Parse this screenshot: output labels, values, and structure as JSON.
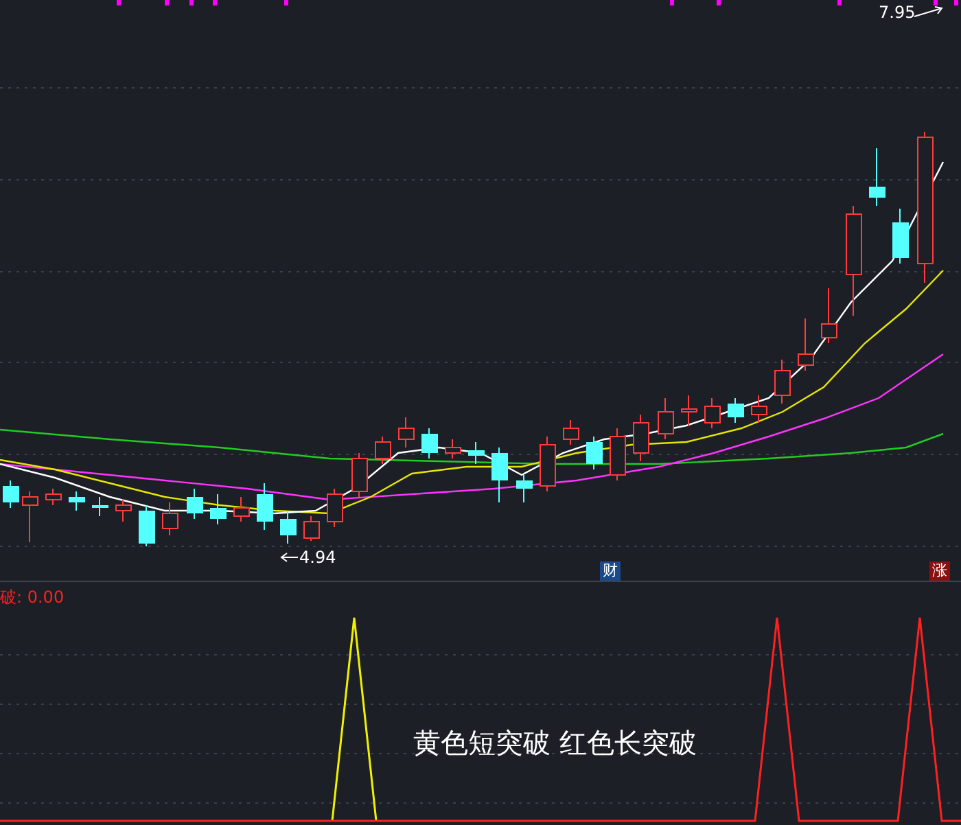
{
  "price_chart": {
    "high_label": "7.95",
    "low_label": "4.94",
    "badges": [
      {
        "text": "财",
        "kind": "finance"
      },
      {
        "text": "涨",
        "kind": "rise"
      }
    ]
  },
  "indicator": {
    "label": "破: 0.00",
    "caption": "黄色短突破 红色长突破"
  }
}
